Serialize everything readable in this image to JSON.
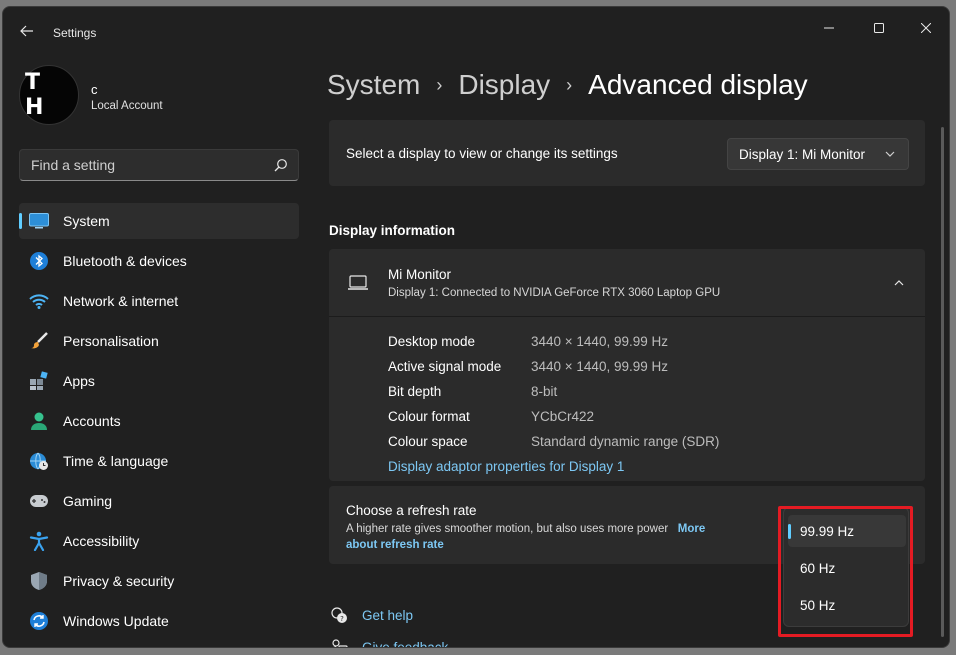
{
  "window": {
    "title": "Settings",
    "controls": {
      "minimize": "minimize-icon",
      "maximize": "maximize-icon",
      "close": "close-icon"
    }
  },
  "user": {
    "initials": "T H",
    "name": "c",
    "account_type": "Local Account"
  },
  "search": {
    "placeholder": "Find a setting"
  },
  "sidebar": {
    "items": [
      {
        "label": "System",
        "icon": "system-icon",
        "active": true
      },
      {
        "label": "Bluetooth & devices",
        "icon": "bluetooth-icon"
      },
      {
        "label": "Network & internet",
        "icon": "wifi-icon"
      },
      {
        "label": "Personalisation",
        "icon": "brush-icon"
      },
      {
        "label": "Apps",
        "icon": "apps-icon"
      },
      {
        "label": "Accounts",
        "icon": "accounts-icon"
      },
      {
        "label": "Time & language",
        "icon": "globe-clock-icon"
      },
      {
        "label": "Gaming",
        "icon": "gamepad-icon"
      },
      {
        "label": "Accessibility",
        "icon": "accessibility-icon"
      },
      {
        "label": "Privacy & security",
        "icon": "shield-icon"
      },
      {
        "label": "Windows Update",
        "icon": "update-icon"
      }
    ]
  },
  "breadcrumb": {
    "level1": "System",
    "level2": "Display",
    "current": "Advanced display"
  },
  "display_select": {
    "label": "Select a display to view or change its settings",
    "value": "Display 1: Mi Monitor"
  },
  "display_info": {
    "section_title": "Display information",
    "monitor_name": "Mi Monitor",
    "monitor_sub": "Display 1: Connected to NVIDIA GeForce RTX 3060 Laptop GPU",
    "rows": [
      {
        "key": "Desktop mode",
        "value": "3440 × 1440, 99.99 Hz"
      },
      {
        "key": "Active signal mode",
        "value": "3440 × 1440, 99.99 Hz"
      },
      {
        "key": "Bit depth",
        "value": "8-bit"
      },
      {
        "key": "Colour format",
        "value": "YCbCr422"
      },
      {
        "key": "Colour space",
        "value": "Standard dynamic range (SDR)"
      }
    ],
    "adaptor_link": "Display adaptor properties for Display 1"
  },
  "refresh_rate": {
    "title": "Choose a refresh rate",
    "description": "A higher rate gives smoother motion, but also uses more power",
    "more_link_1": "More",
    "more_link_2": "about refresh rate",
    "options": [
      "99.99 Hz",
      "60 Hz",
      "50 Hz"
    ],
    "selected": "99.99 Hz"
  },
  "help": {
    "get_help": "Get help",
    "give_feedback": "Give feedback"
  },
  "colors": {
    "accent": "#60cdff",
    "link": "#7dc8f4",
    "highlight": "#e41b23",
    "background": "#202020",
    "card": "#2b2b2b"
  }
}
